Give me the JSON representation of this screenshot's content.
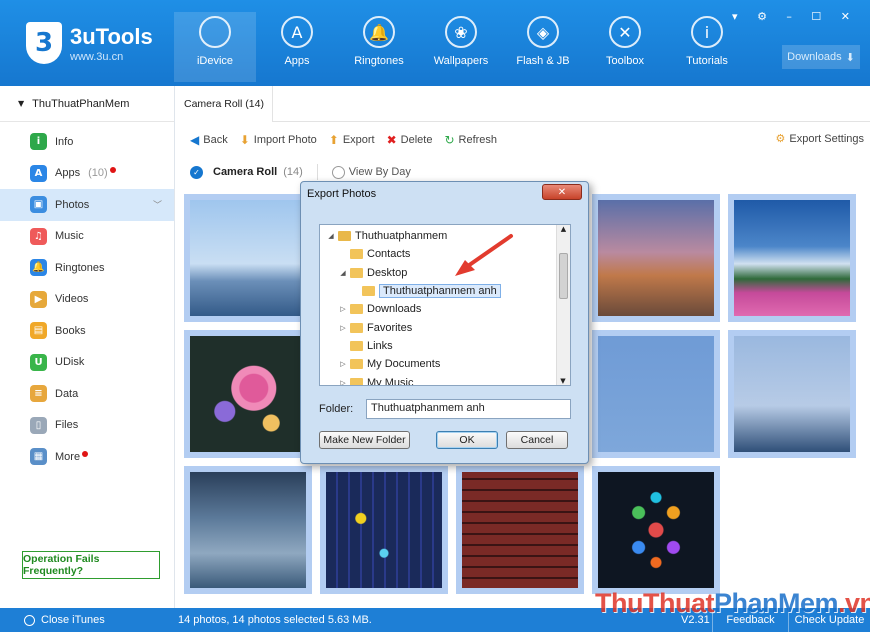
{
  "app": {
    "name": "3uTools",
    "url": "www.3u.cn",
    "logo_glyph": "3"
  },
  "nav": [
    {
      "label": "iDevice",
      "icon": "apple-icon",
      "glyph": "",
      "active": true
    },
    {
      "label": "Apps",
      "icon": "app-store-icon",
      "glyph": "A"
    },
    {
      "label": "Ringtones",
      "icon": "bell-icon",
      "glyph": "🔔"
    },
    {
      "label": "Wallpapers",
      "icon": "flower-icon",
      "glyph": "❀"
    },
    {
      "label": "Flash & JB",
      "icon": "dropbox-icon",
      "glyph": "◈"
    },
    {
      "label": "Toolbox",
      "icon": "tools-icon",
      "glyph": "✕"
    },
    {
      "label": "Tutorials",
      "icon": "info-icon",
      "glyph": "i"
    }
  ],
  "window_controls": "▾ ⚙ – ☐ ✕",
  "downloads": {
    "label": "Downloads",
    "glyph": "⬇"
  },
  "sidebar": {
    "device_name": "ThuThuatPhanMem",
    "items": [
      {
        "label": "Info",
        "icon": "info-icon",
        "color": "#2ea84a",
        "glyph": "i"
      },
      {
        "label": "Apps",
        "count": "(10)",
        "icon": "app-store-icon",
        "color": "#2b86e6",
        "glyph": "A",
        "dot": true
      },
      {
        "label": "Photos",
        "icon": "photo-icon",
        "color": "#3b8de0",
        "glyph": "▣",
        "active": true
      },
      {
        "label": "Music",
        "icon": "music-icon",
        "color": "#ef5a5a",
        "glyph": "♫"
      },
      {
        "label": "Ringtones",
        "icon": "bell-icon",
        "color": "#2b86e6",
        "glyph": "🔔"
      },
      {
        "label": "Videos",
        "icon": "video-icon",
        "color": "#e6a83a",
        "glyph": "▶"
      },
      {
        "label": "Books",
        "icon": "book-icon",
        "color": "#f0a829",
        "glyph": "▤"
      },
      {
        "label": "UDisk",
        "icon": "udisk-icon",
        "color": "#39b54a",
        "glyph": "U"
      },
      {
        "label": "Data",
        "icon": "data-icon",
        "color": "#e7a73d",
        "glyph": "≡"
      },
      {
        "label": "Files",
        "icon": "file-icon",
        "color": "#9aa8b8",
        "glyph": "▯"
      },
      {
        "label": "More",
        "icon": "grid-icon",
        "color": "#5a8fc8",
        "glyph": "▦",
        "dot": true
      }
    ],
    "op_fail": "Operation Fails Frequently?"
  },
  "main": {
    "tab": "Camera Roll (14)",
    "toolbar": [
      {
        "label": "Back",
        "icon": "back-icon",
        "glyph": "◀",
        "color": "#1677cf"
      },
      {
        "label": "Import Photo",
        "icon": "import-icon",
        "glyph": "⬇",
        "color": "#e8a233"
      },
      {
        "label": "Export",
        "icon": "export-icon",
        "glyph": "⬆",
        "color": "#e8a233"
      },
      {
        "label": "Delete",
        "icon": "delete-icon",
        "glyph": "✖",
        "color": "#e02020"
      },
      {
        "label": "Refresh",
        "icon": "refresh-icon",
        "glyph": "↻",
        "color": "#2ea84a"
      }
    ],
    "export_settings": "Export Settings",
    "filter": {
      "camera_roll": "Camera Roll",
      "count": "(14)",
      "view_by_day": "View By Day"
    }
  },
  "photos": [
    {
      "bg": "linear-gradient(#9fc6ee 0%,#c9def3 55%,#6b8fb8 70%,#335a88 100%)"
    },
    {
      "bg": "linear-gradient(#8fb0e0,#aecbf0)"
    },
    {
      "bg": "linear-gradient(#8fb0e0,#aecbf0)"
    },
    {
      "bg": "linear-gradient(#5a6fa8 0%,#b98aa0 45%,#c0794a 65%,#6a4a3a 100%)"
    },
    {
      "bg": "linear-gradient(#1f5aa8 0%,#4c86c9 40%,#d0e0f0 55%,#2f6a3a 68%,#c54a9a 80%,#e06ab0 100%)"
    },
    {
      "bg": "radial-gradient(circle at 55% 45%,#e05a9a 0 14px,#f08ab8 15px 22px,transparent 23px),radial-gradient(circle at 30% 65%,#8a6ad8 0 10px,transparent 11px),radial-gradient(circle at 70% 75%,#f0c060 0 8px,transparent 9px),#1f2f2a"
    },
    {
      "bg": "linear-gradient(#8fb0e0,#aecbf0)"
    },
    {
      "bg": "linear-gradient(#8fb0e0,#aecbf0)"
    },
    {
      "bg": "linear-gradient(#6f9bd6,#7ea7da)"
    },
    {
      "bg": "linear-gradient(#9ab8df 0%,#b7cbe6 60%,#2f4f78 100%)"
    },
    {
      "bg": "linear-gradient(#2a3f5a 0%,#5c7a9a 40%,#8fa8c0 70%,#3a5a7a 100%)"
    },
    {
      "bg": "radial-gradient(circle at 30% 40%,#f0d020 0 5px,transparent 6px),radial-gradient(circle at 50% 70%,#5ad0f0 0 4px,transparent 5px),repeating-linear-gradient(90deg,#1a2a5a 0 10px,#2a3a8a 10px 12px),#14214a"
    },
    {
      "bg": "repeating-linear-gradient(0deg,#7a2a26 0 9px,#3a1414 9px 11px)"
    },
    {
      "bg": "radial-gradient(circle at 50% 50%,#e04a4a 0 7px,transparent 8px),radial-gradient(circle at 35% 35%,#4ac05a 0 6px,transparent 7px),radial-gradient(circle at 65% 35%,#f0a020 0 6px,transparent 7px),radial-gradient(circle at 35% 65%,#3a8af0 0 6px,transparent 7px),radial-gradient(circle at 65% 65%,#a04af0 0 6px,transparent 7px),radial-gradient(circle at 50% 22%,#20c0e0 0 5px,transparent 6px),radial-gradient(circle at 50% 78%,#f06a20 0 5px,transparent 6px),#0e1622"
    }
  ],
  "dialog": {
    "title": "Export Photos",
    "close": "✕",
    "tree": [
      {
        "label": "Thuthuatphanmem",
        "indent": 0,
        "twisty": "◢",
        "icon": "user-folder-icon"
      },
      {
        "label": "Contacts",
        "indent": 1,
        "twisty": "",
        "icon": "folder-icon"
      },
      {
        "label": "Desktop",
        "indent": 1,
        "twisty": "◢",
        "icon": "folder-icon"
      },
      {
        "label": "Thuthuatphanmem anh",
        "indent": 2,
        "twisty": "",
        "icon": "folder-icon",
        "selected": true
      },
      {
        "label": "Downloads",
        "indent": 1,
        "twisty": "▷",
        "icon": "folder-icon"
      },
      {
        "label": "Favorites",
        "indent": 1,
        "twisty": "▷",
        "icon": "folder-icon"
      },
      {
        "label": "Links",
        "indent": 1,
        "twisty": "",
        "icon": "folder-icon"
      },
      {
        "label": "My Documents",
        "indent": 1,
        "twisty": "▷",
        "icon": "folder-icon"
      },
      {
        "label": "My Music",
        "indent": 1,
        "twisty": "▷",
        "icon": "folder-icon"
      }
    ],
    "folder_label": "Folder:",
    "folder_value": "Thuthuatphanmem anh",
    "make_new_folder": "Make New Folder",
    "ok": "OK",
    "cancel": "Cancel"
  },
  "status": {
    "close_itunes": "Close iTunes",
    "summary": "14 photos, 14 photos selected 5.63 MB.",
    "version": "V2.31",
    "feedback": "Feedback",
    "check_update": "Check Update"
  },
  "watermark": {
    "part1": "ThuThuat",
    "part2": "PhanMem",
    "part3": ".vn"
  }
}
